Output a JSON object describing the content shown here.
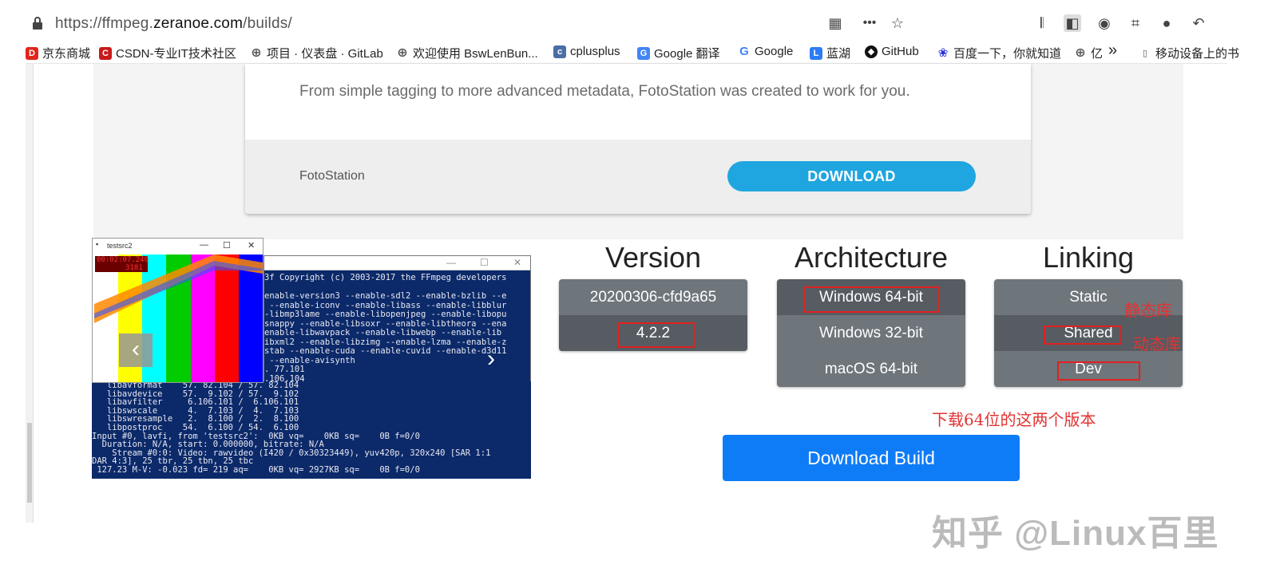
{
  "browser": {
    "url_prefix": "https://ffmpeg.",
    "url_domain": "zeranoe.com",
    "url_path": "/builds/",
    "more_label": "•••"
  },
  "bookmarks": [
    {
      "label": "京东商城",
      "icon": "jd-icon",
      "color": "#e1251b"
    },
    {
      "label": "CSDN-专业IT技术社区",
      "icon": "csdn-icon",
      "color": "#c91a1a"
    },
    {
      "label": "项目 · 仪表盘 · GitLab",
      "icon": "globe-icon",
      "color": "#555555"
    },
    {
      "label": "欢迎使用 BswLenBun...",
      "icon": "globe-icon",
      "color": "#555555"
    },
    {
      "label": "cplusplus",
      "icon": "cplusplus-icon",
      "color": "#4a6fa5"
    },
    {
      "label": "Google 翻译",
      "icon": "google-translate-icon",
      "color": "#4285f4"
    },
    {
      "label": "Google",
      "icon": "google-icon",
      "color": "#4285f4"
    },
    {
      "label": "蓝湖",
      "icon": "lanhu-icon",
      "color": "#2d7cf6"
    },
    {
      "label": "GitHub",
      "icon": "github-icon",
      "color": "#111111"
    },
    {
      "label": "百度一下，你就知道",
      "icon": "baidu-icon",
      "color": "#2932e1"
    },
    {
      "label": "亿",
      "icon": "globe-icon",
      "color": "#555555"
    },
    {
      "label": "移动设备上的书",
      "icon": "mobile-icon",
      "color": "#555555"
    }
  ],
  "product_card": {
    "description": "From simple tagging to more advanced metadata, FotoStation was created to work for you.",
    "name": "FotoStation",
    "download_label": "DOWNLOAD"
  },
  "preview": {
    "test_window_title": "testsrc2",
    "timestamp": "00:02:07.240",
    "frame": "3181",
    "console_lines": [
      "3f Copyright (c) 2003-2017 the FFmpeg developers",
      "",
      "enable-version3 --enable-sdl2 --enable-bzlib --e",
      " --enable-iconv --enable-libass --enable-libblur",
      "-libmp3lame --enable-libopenjpeg --enable-libopu",
      "snappy --enable-libsoxr --enable-libtheora --ena",
      "enable-libwavpack --enable-libwebp --enable-lib",
      "ibxml2 --enable-libzimg --enable-lzma --enable-z",
      "stab --enable-cuda --enable-cuvid --enable-d3d11",
      " --enable-avisynth",
      ". 77.101",
      ".106.104"
    ],
    "lower_lines": [
      "   libavformat    57. 82.104 / 57. 82.104",
      "   libavdevice    57.  9.102 / 57.  9.102",
      "   libavfilter     6.106.101 /  6.106.101",
      "   libswscale      4.  7.103 /  4.  7.103",
      "   libswresample   2.  8.100 /  2.  8.100",
      "   libpostproc    54.  6.100 / 54.  6.100",
      "Input #0, lavfi, from 'testsrc2':  0KB vq=    0KB sq=    0B f=0/0",
      "  Duration: N/A, start: 0.000000, bitrate: N/A",
      "    Stream #0:0: Video: rawvideo (I420 / 0x30323449), yuv420p, 320x240 [SAR 1:1",
      "DAR 4:3], 25 tbr, 25 tbn, 25 tbc",
      " 127.23 M-V: -0.023 fd= 219 aq=    0KB vq= 2927KB sq=    0B f=0/0"
    ]
  },
  "selectors": {
    "version": {
      "title": "Version",
      "options": [
        "20200306-cfd9a65",
        "4.2.2"
      ],
      "selected": "4.2.2"
    },
    "architecture": {
      "title": "Architecture",
      "options": [
        "Windows 64-bit",
        "Windows 32-bit",
        "macOS 64-bit"
      ],
      "selected": "Windows 64-bit"
    },
    "linking": {
      "title": "Linking",
      "options": [
        "Static",
        "Shared",
        "Dev"
      ],
      "selected": "Shared"
    }
  },
  "annotations": {
    "static": "静态库",
    "shared": "动态库",
    "note": "下载64位的这两个版本"
  },
  "download_build_label": "Download Build",
  "watermark": "知乎 @Linux百里",
  "colors": {
    "card_button": "#1fa6e0",
    "build_button": "#0f7cf7",
    "selector_bg": "#6e757b",
    "selector_active": "#565c62",
    "annotation_red": "#e23333"
  }
}
